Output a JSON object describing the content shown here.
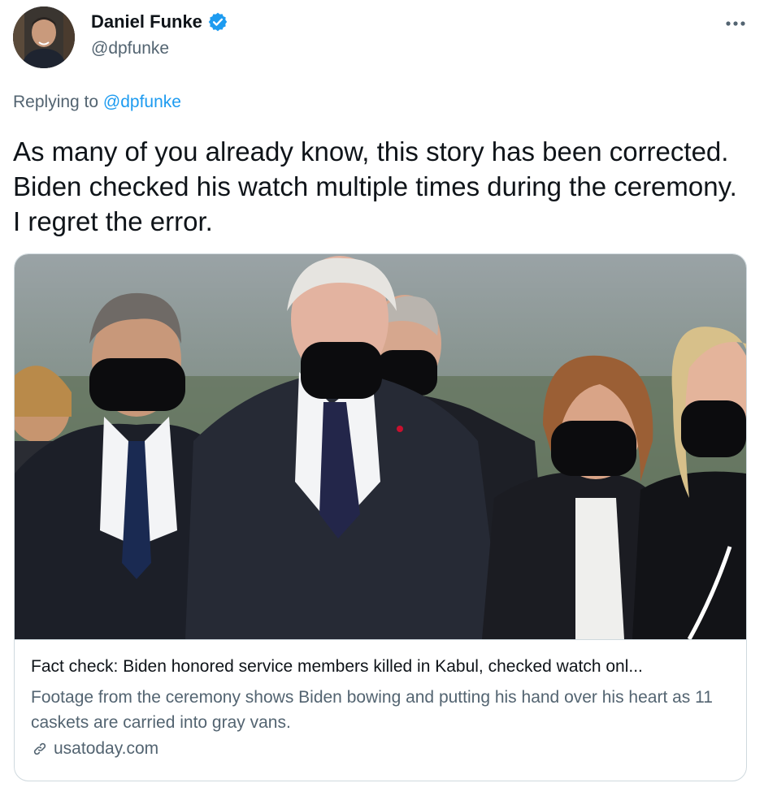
{
  "author": {
    "display_name": "Daniel Funke",
    "handle": "@dpfunke",
    "verified": true,
    "avatar": "author-avatar"
  },
  "reply": {
    "prefix": "Replying to",
    "handle": "@dpfunke"
  },
  "tweet": {
    "text": "As many of you already know, this story has been corrected. Biden checked his watch multiple times during the ceremony. I regret the error."
  },
  "card": {
    "title": "Fact check: Biden honored service members killed in Kabul, checked watch onl...",
    "description": "Footage from the ceremony shows Biden bowing and putting his hand over his heart as 11 caskets are carried into gray vans.",
    "domain": "usatoday.com",
    "domain_icon": "link-icon"
  },
  "icons": {
    "more": "more-icon",
    "verified": "verified-badge-icon"
  },
  "colors": {
    "accent": "#1d9bf0",
    "text_primary": "#0f1419",
    "text_secondary": "#536471",
    "border": "#cfd9de"
  }
}
